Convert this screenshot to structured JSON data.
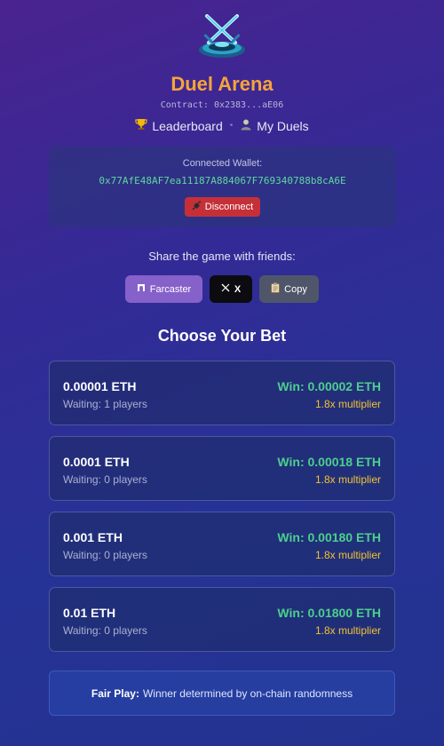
{
  "header": {
    "title": "Duel Arena",
    "contract": "Contract: 0x2383...aE06",
    "logo_icon": "crossed-swords-arena-icon"
  },
  "nav": {
    "leaderboard_label": "Leaderboard",
    "leaderboard_icon": "trophy-icon",
    "my_duels_label": "My Duels",
    "my_duels_icon": "user-icon",
    "separator": "•"
  },
  "wallet": {
    "label": "Connected Wallet:",
    "address": "0x77AfE48AF7ea11187A884067F769340788b8cA6E",
    "disconnect_label": "Disconnect",
    "disconnect_icon": "plug-icon"
  },
  "share": {
    "label": "Share the game with friends:",
    "farcaster_label": "Farcaster",
    "x_label": "X",
    "copy_label": "Copy"
  },
  "bets": {
    "title": "Choose Your Bet",
    "items": [
      {
        "amount": "0.00001 ETH",
        "waiting": "Waiting: 1 players",
        "win": "Win: 0.00002 ETH",
        "multiplier": "1.8x multiplier"
      },
      {
        "amount": "0.0001 ETH",
        "waiting": "Waiting: 0 players",
        "win": "Win: 0.00018 ETH",
        "multiplier": "1.8x multiplier"
      },
      {
        "amount": "0.001 ETH",
        "waiting": "Waiting: 0 players",
        "win": "Win: 0.00180 ETH",
        "multiplier": "1.8x multiplier"
      },
      {
        "amount": "0.01 ETH",
        "waiting": "Waiting: 0 players",
        "win": "Win: 0.01800 ETH",
        "multiplier": "1.8x multiplier"
      }
    ]
  },
  "footer": {
    "fair_label": "Fair Play:",
    "fair_text": "Winner determined by on-chain randomness"
  },
  "colors": {
    "accent_title": "#f5a43a",
    "win_green": "#4ccf8d",
    "multiplier_yellow": "#f2c230",
    "disconnect_red": "#c53038",
    "farcaster_purple": "#8661c9"
  }
}
